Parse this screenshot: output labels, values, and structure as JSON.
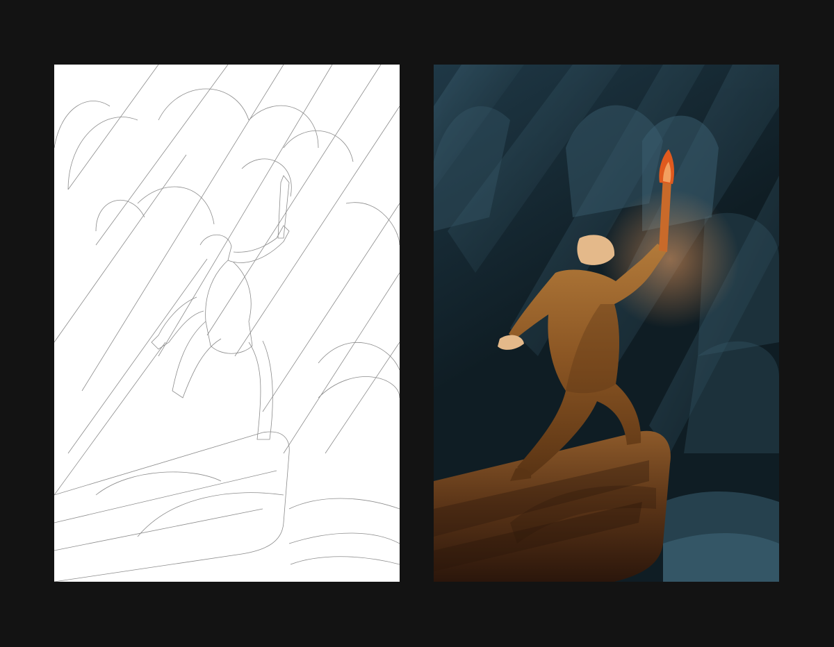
{
  "colors": {
    "backdrop": "#131313",
    "lineart_bg": "#ffffff",
    "lineart_stroke": "#8a8a8a",
    "night_dark": "#0f1d24",
    "night_mid": "#1f3846",
    "night_light": "#3b5f71",
    "rock_dark": "#2b160b",
    "rock_mid": "#5a3417",
    "rock_light": "#8d5a2a",
    "figure_dark": "#5a3414",
    "figure_mid": "#8a5523",
    "figure_light": "#b27a3a",
    "skin": "#e4b98a",
    "torch_flame": "#e05a1e",
    "torch_glow": "#f3a060",
    "torch_handle": "#c96a2a"
  },
  "panels": [
    {
      "id": "lineart",
      "style": "outline",
      "subject": "figure-holding-torch-on-cliff"
    },
    {
      "id": "colored",
      "style": "filled",
      "subject": "figure-holding-torch-on-cliff"
    }
  ]
}
